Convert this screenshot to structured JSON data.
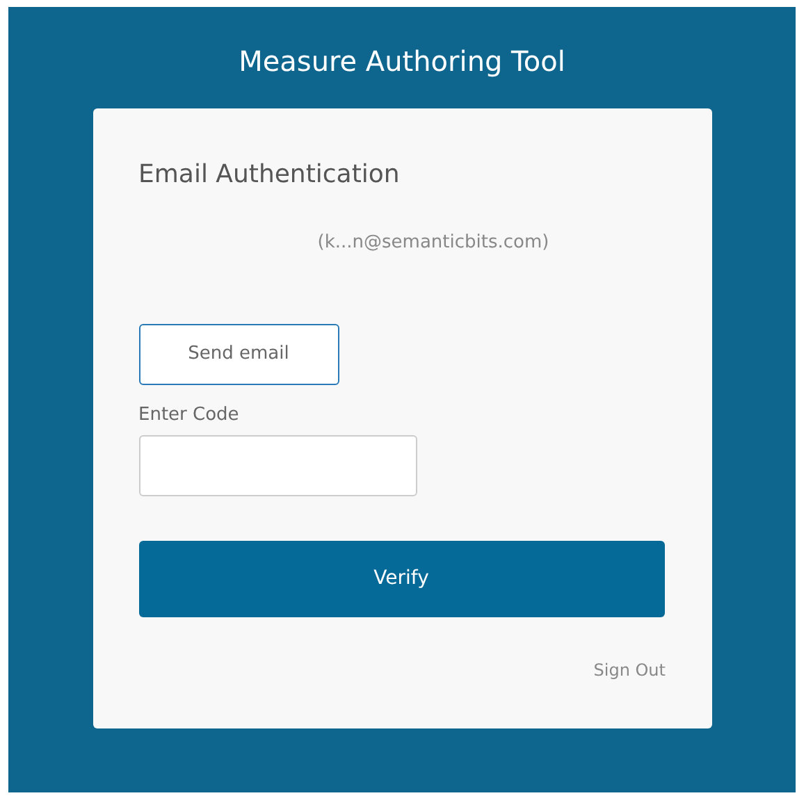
{
  "app_title": "Measure Authoring Tool",
  "card": {
    "heading": "Email Authentication",
    "email": "(k...n@semanticbits.com)",
    "send_button": "Send email",
    "code_label": "Enter Code",
    "verify_button": "Verify",
    "sign_out": "Sign Out"
  }
}
